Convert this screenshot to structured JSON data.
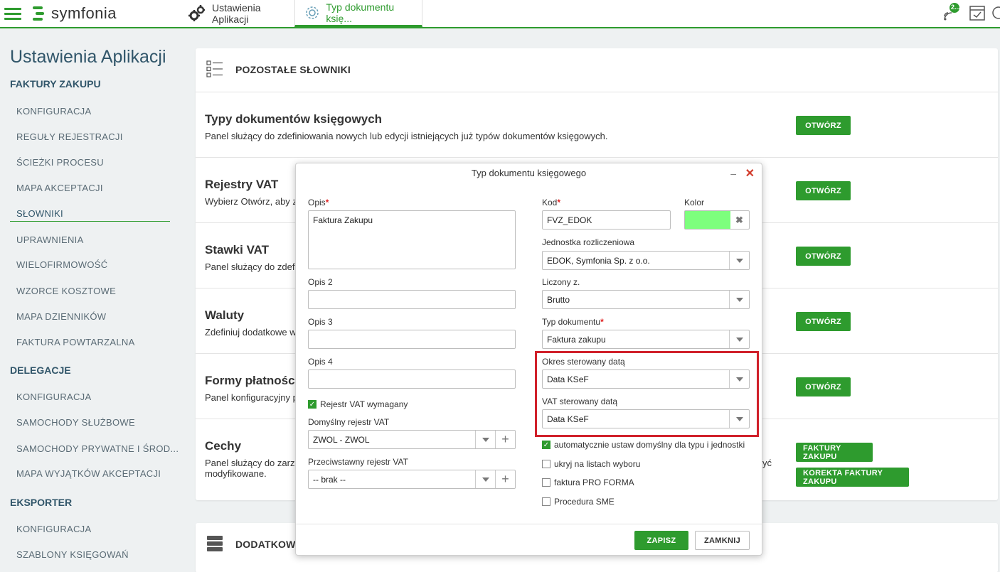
{
  "app": {
    "brand": "symfonia"
  },
  "tabs": [
    {
      "label": "Ustawienia Aplikacji"
    },
    {
      "label": "Typ dokumentu księ..."
    }
  ],
  "header_icons": {
    "notification_badge": "2..."
  },
  "sidebar": {
    "title": "Ustawienia Aplikacji",
    "groups": [
      {
        "label": "FAKTURY ZAKUPU",
        "items": [
          "KONFIGURACJA",
          "REGUŁY REJESTRACJI",
          "ŚCIEŻKI PROCESU",
          "MAPA AKCEPTACJI",
          "SŁOWNIKI",
          "UPRAWNIENIA",
          "WIELOFIRMOWOŚĆ",
          "WZORCE KOSZTOWE",
          "MAPA DZIENNIKÓW",
          "FAKTURA POWTARZALNA"
        ]
      },
      {
        "label": "DELEGACJE",
        "items": [
          "KONFIGURACJA",
          "SAMOCHODY SŁUŻBOWE",
          "SAMOCHODY PRYWATNE I ŚROD...",
          "MAPA WYJĄTKÓW AKCEPTACJI"
        ]
      },
      {
        "label": "EKSPORTER",
        "items": [
          "KONFIGURACJA",
          "SZABLONY KSIĘGOWAŃ"
        ]
      }
    ]
  },
  "main": {
    "section_title": "POZOSTAŁE SŁOWNIKI",
    "rows": [
      {
        "title": "Typy dokumentów księgowych",
        "desc": "Panel służący do zdefiniowania nowych lub edycji istniejących już typów dokumentów księgowych.",
        "button": "OTWÓRZ"
      },
      {
        "title": "Rejestry VAT",
        "desc": "Wybierz Otwórz, aby zo",
        "button": "OTWÓRZ"
      },
      {
        "title": "Stawki VAT",
        "desc": "Panel służący do zdefi",
        "button": "OTWÓRZ"
      },
      {
        "title": "Waluty",
        "desc": "Zdefiniuj dodatkowe w",
        "button": "OTWÓRZ"
      },
      {
        "title": "Formy płatności",
        "desc": "Panel konfiguracyjny p",
        "button": "OTWÓRZ"
      },
      {
        "title": "Cechy",
        "desc": "Panel służący do zarzą",
        "desc2": "modyfikowane.",
        "desc_tail": "yć",
        "button": "FAKTURY ZAKUPU",
        "button2": "KOREKTA FAKTURY ZAKUPU"
      }
    ],
    "section2_title": "DODATKOWE"
  },
  "modal": {
    "title": "Typ dokumentu księgowego",
    "opis_label": "Opis",
    "opis_value": "Faktura Zakupu",
    "opis2_label": "Opis 2",
    "opis3_label": "Opis 3",
    "opis4_label": "Opis 4",
    "rejestr_vat_wymagany": "Rejestr VAT wymagany",
    "domyslny_rejestr_label": "Domyślny rejestr VAT",
    "domyslny_rejestr_value": "ZWOL - ZWOL",
    "przeciwstawny_label": "Przeciwstawny rejestr VAT",
    "przeciwstawny_value": "-- brak --",
    "kod_label": "Kod",
    "kod_value": "FVZ_EDOK",
    "kolor_label": "Kolor",
    "kolor_value": "#7dff7d",
    "jednostka_label": "Jednostka rozliczeniowa",
    "jednostka_value": "EDOK, Symfonia Sp. z o.o.",
    "liczony_label": "Liczony z.",
    "liczony_value": "Brutto",
    "typ_label": "Typ dokumentu",
    "typ_value": "Faktura zakupu",
    "okres_label": "Okres sterowany datą",
    "okres_value": "Data KSeF",
    "vat_label": "VAT sterowany datą",
    "vat_value": "Data KSeF",
    "cb_auto": "automatycznie ustaw domyślny dla typu i jednostki",
    "cb_ukryj": "ukryj na listach wyboru",
    "cb_proforma": "faktura PRO FORMA",
    "cb_sme": "Procedura SME",
    "save": "ZAPISZ",
    "close": "ZAMKNIJ"
  }
}
